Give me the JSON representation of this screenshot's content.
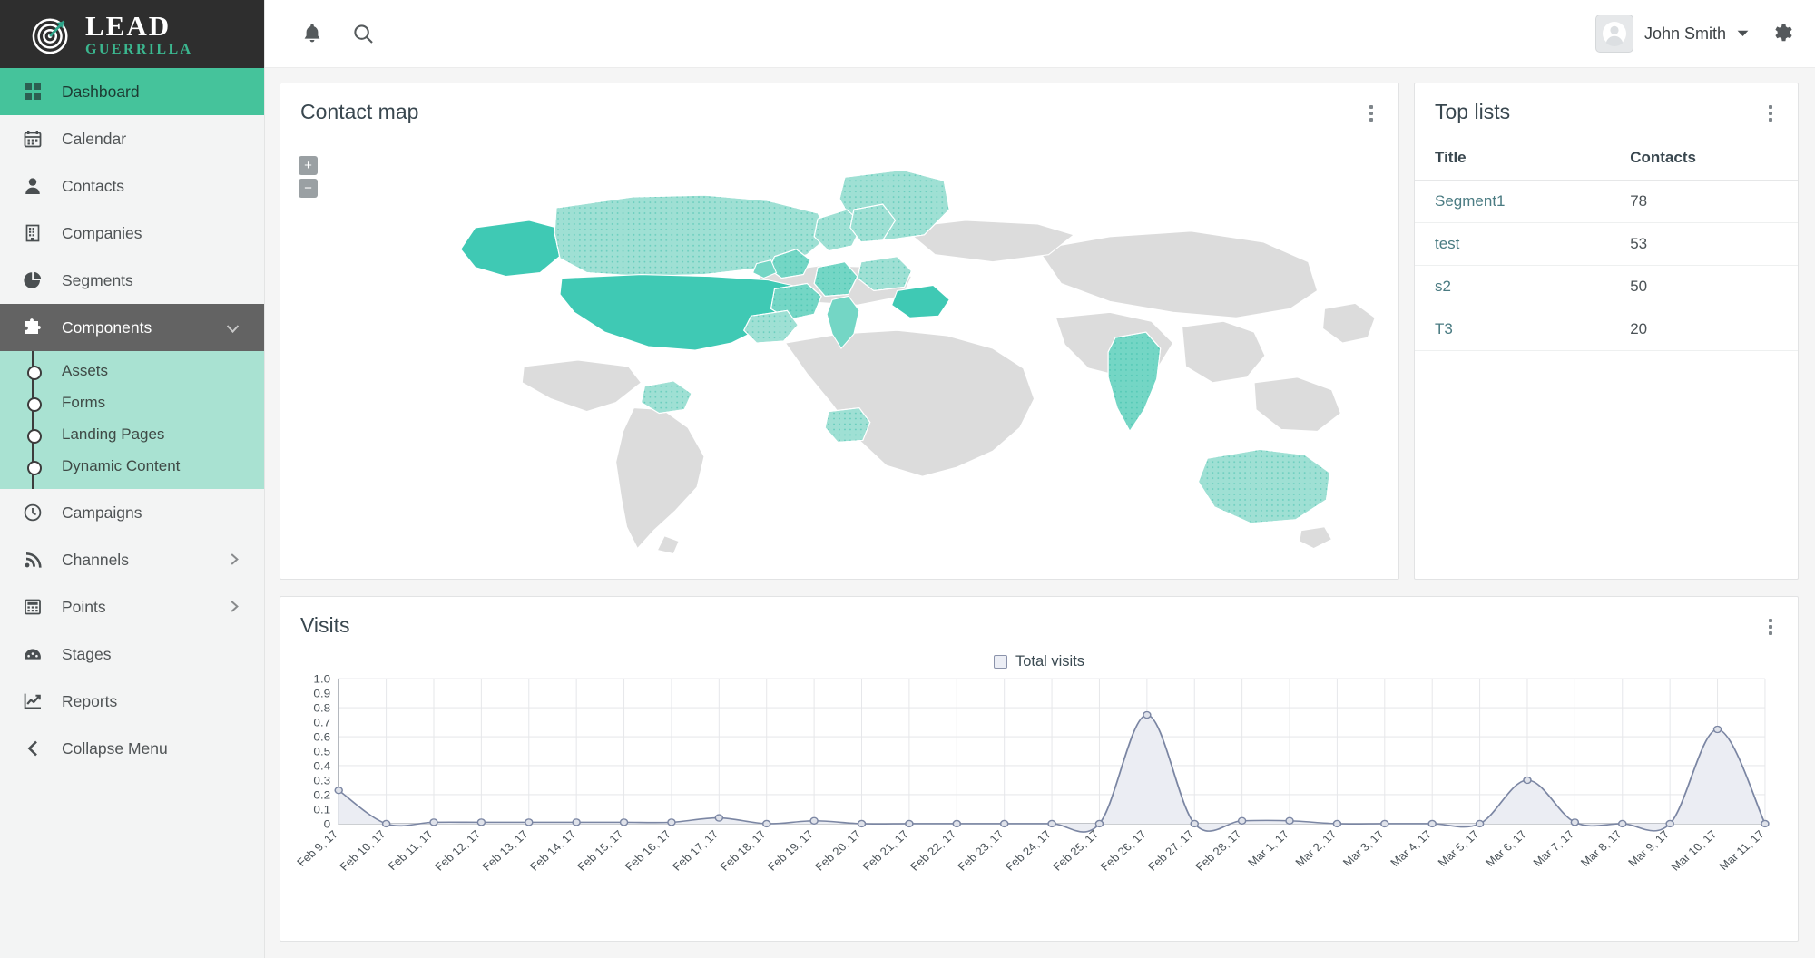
{
  "brand": {
    "line1": "LEAD",
    "line2": "GUERRILLA",
    "logo_icon": "target-arrow-icon"
  },
  "colors": {
    "brand_green": "#45c39b",
    "brand_green_text": "#3bb78f",
    "map_strong": "#3fc9b4",
    "map_mid": "#74d6c5",
    "map_light": "#9fe0d4",
    "map_inactive": "#dcdcdc",
    "submenu_bg": "#a9e2d2",
    "sidebar_bg": "#f3f4f4",
    "topbar_dark": "#2e2e2e",
    "chart_line": "#7b86a3",
    "chart_fill": "#ebedf3"
  },
  "sidebar": {
    "items": [
      {
        "label": "Dashboard",
        "icon": "grid-icon",
        "state": "active"
      },
      {
        "label": "Calendar",
        "icon": "calendar-icon",
        "state": "normal"
      },
      {
        "label": "Contacts",
        "icon": "user-icon",
        "state": "normal"
      },
      {
        "label": "Companies",
        "icon": "building-icon",
        "state": "normal"
      },
      {
        "label": "Segments",
        "icon": "pie-chart-icon",
        "state": "normal"
      },
      {
        "label": "Components",
        "icon": "puzzle-icon",
        "state": "open",
        "caret": "chevron-down-icon"
      },
      {
        "label": "Campaigns",
        "icon": "clock-icon",
        "state": "normal"
      },
      {
        "label": "Channels",
        "icon": "rss-icon",
        "state": "normal",
        "caret": "chevron-right-icon"
      },
      {
        "label": "Points",
        "icon": "calculator-icon",
        "state": "normal",
        "caret": "chevron-right-icon"
      },
      {
        "label": "Stages",
        "icon": "gauge-icon",
        "state": "normal"
      },
      {
        "label": "Reports",
        "icon": "line-chart-icon",
        "state": "normal"
      },
      {
        "label": "Collapse Menu",
        "icon": "chevron-left-icon",
        "state": "normal"
      }
    ],
    "submenu": [
      {
        "label": "Assets"
      },
      {
        "label": "Forms"
      },
      {
        "label": "Landing Pages"
      },
      {
        "label": "Dynamic Content"
      }
    ]
  },
  "topbar": {
    "notifications_icon": "bell-icon",
    "search_icon": "search-icon",
    "user_name": "John Smith",
    "user_caret_icon": "caret-down-icon",
    "avatar_icon": "user-avatar-icon",
    "settings_icon": "gear-icon"
  },
  "contact_map": {
    "title": "Contact map",
    "zoom_in_label": "+",
    "zoom_out_label": "−",
    "menu_icon": "kebab-menu-icon",
    "highlighted_countries": [
      {
        "name": "United States",
        "level": "strong"
      },
      {
        "name": "Alaska",
        "level": "strong"
      },
      {
        "name": "Canada",
        "level": "light"
      },
      {
        "name": "Greenland",
        "level": "light"
      },
      {
        "name": "United Kingdom",
        "level": "mid"
      },
      {
        "name": "Ireland",
        "level": "mid"
      },
      {
        "name": "France",
        "level": "mid"
      },
      {
        "name": "Spain",
        "level": "light"
      },
      {
        "name": "Germany",
        "level": "mid"
      },
      {
        "name": "Italy",
        "level": "mid"
      },
      {
        "name": "Poland",
        "level": "light"
      },
      {
        "name": "Romania",
        "level": "strong"
      },
      {
        "name": "Norway",
        "level": "light"
      },
      {
        "name": "Sweden",
        "level": "light"
      },
      {
        "name": "India",
        "level": "mid"
      },
      {
        "name": "Nigeria",
        "level": "light"
      },
      {
        "name": "Australia",
        "level": "light"
      },
      {
        "name": "Venezuela",
        "level": "light"
      },
      {
        "name": "Colombia",
        "level": "light"
      }
    ]
  },
  "top_lists": {
    "title": "Top lists",
    "menu_icon": "kebab-menu-icon",
    "columns": [
      "Title",
      "Contacts"
    ],
    "rows": [
      {
        "title": "Segment1",
        "contacts": "78"
      },
      {
        "title": "test",
        "contacts": "53"
      },
      {
        "title": "s2",
        "contacts": "50"
      },
      {
        "title": "T3",
        "contacts": "20"
      }
    ]
  },
  "visits": {
    "title": "Visits",
    "menu_icon": "kebab-menu-icon",
    "legend_label": "Total visits"
  },
  "chart_data": {
    "type": "area",
    "title": "Visits",
    "xlabel": "",
    "ylabel": "",
    "ylim": [
      0,
      1.0
    ],
    "grid": true,
    "legend_position": "top-center",
    "legend": [
      "Total visits"
    ],
    "y_ticks": [
      "0",
      "0.1",
      "0.2",
      "0.3",
      "0.4",
      "0.5",
      "0.6",
      "0.7",
      "0.8",
      "0.9",
      "1.0"
    ],
    "categories": [
      "Feb 9, 17",
      "Feb 10, 17",
      "Feb 11, 17",
      "Feb 12, 17",
      "Feb 13, 17",
      "Feb 14, 17",
      "Feb 15, 17",
      "Feb 16, 17",
      "Feb 17, 17",
      "Feb 18, 17",
      "Feb 19, 17",
      "Feb 20, 17",
      "Feb 21, 17",
      "Feb 22, 17",
      "Feb 23, 17",
      "Feb 24, 17",
      "Feb 25, 17",
      "Feb 26, 17",
      "Feb 27, 17",
      "Feb 28, 17",
      "Mar 1, 17",
      "Mar 2, 17",
      "Mar 3, 17",
      "Mar 4, 17",
      "Mar 5, 17",
      "Mar 6, 17",
      "Mar 7, 17",
      "Mar 8, 17",
      "Mar 9, 17",
      "Mar 10, 17",
      "Mar 11, 17"
    ],
    "series": [
      {
        "name": "Total visits",
        "values": [
          0.23,
          0,
          0.01,
          0.01,
          0.01,
          0.01,
          0.01,
          0.01,
          0.04,
          0,
          0.02,
          0,
          0,
          0,
          0,
          0,
          0,
          0.75,
          0,
          0.02,
          0.02,
          0,
          0,
          0,
          0,
          0.3,
          0.01,
          0,
          0,
          0.65,
          0
        ]
      }
    ]
  }
}
